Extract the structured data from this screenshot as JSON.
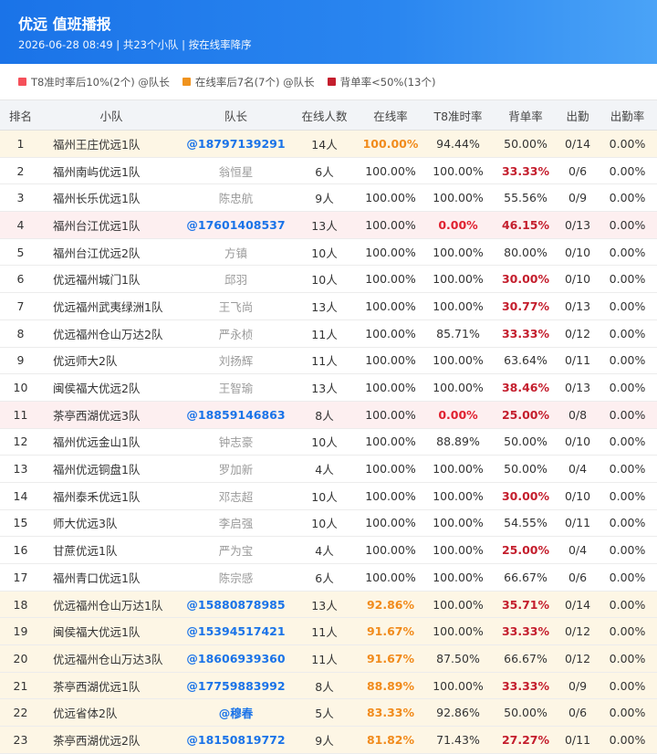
{
  "header": {
    "title": "优远 值班播报",
    "subtitle": "2026-06-28 08:49 | 共23个小队 | 按在线率降序"
  },
  "legend": [
    {
      "label": "T8准时率后10%(2个) @队长",
      "color": "#f5505a"
    },
    {
      "label": "在线率后7名(7个) @队长",
      "color": "#f0931e"
    },
    {
      "label": "背单率<50%(13个)",
      "color": "#c41e2d"
    }
  ],
  "columns": [
    "排名",
    "小队",
    "队长",
    "在线人数",
    "在线率",
    "T8准时率",
    "背单率",
    "出勤",
    "出勤率"
  ],
  "rows": [
    {
      "rank": "1",
      "team": "福州王庄优远1队",
      "leader": "@18797139291",
      "online_count": "14人",
      "online_rate": "100.00%",
      "t8_rate": "94.44%",
      "back_rate": "50.00%",
      "attendance": "0/14",
      "attendance_rate": "0.00%",
      "highlight": "orange",
      "leader_style": "blue",
      "online_style": "orange",
      "t8_style": "",
      "back_style": ""
    },
    {
      "rank": "2",
      "team": "福州南屿优远1队",
      "leader": "翁恒星",
      "online_count": "6人",
      "online_rate": "100.00%",
      "t8_rate": "100.00%",
      "back_rate": "33.33%",
      "attendance": "0/6",
      "attendance_rate": "0.00%",
      "highlight": "",
      "leader_style": "gray",
      "online_style": "",
      "t8_style": "",
      "back_style": "red"
    },
    {
      "rank": "3",
      "team": "福州长乐优远1队",
      "leader": "陈忠航",
      "online_count": "9人",
      "online_rate": "100.00%",
      "t8_rate": "100.00%",
      "back_rate": "55.56%",
      "attendance": "0/9",
      "attendance_rate": "0.00%",
      "highlight": "",
      "leader_style": "gray",
      "online_style": "",
      "t8_style": "",
      "back_style": ""
    },
    {
      "rank": "4",
      "team": "福州台江优远1队",
      "leader": "@17601408537",
      "online_count": "13人",
      "online_rate": "100.00%",
      "t8_rate": "0.00%",
      "back_rate": "46.15%",
      "attendance": "0/13",
      "attendance_rate": "0.00%",
      "highlight": "red",
      "leader_style": "blue",
      "online_style": "",
      "t8_style": "red",
      "back_style": "red"
    },
    {
      "rank": "5",
      "team": "福州台江优远2队",
      "leader": "方镇",
      "online_count": "10人",
      "online_rate": "100.00%",
      "t8_rate": "100.00%",
      "back_rate": "80.00%",
      "attendance": "0/10",
      "attendance_rate": "0.00%",
      "highlight": "",
      "leader_style": "gray",
      "online_style": "",
      "t8_style": "",
      "back_style": ""
    },
    {
      "rank": "6",
      "team": "优远福州城门1队",
      "leader": "邱羽",
      "online_count": "10人",
      "online_rate": "100.00%",
      "t8_rate": "100.00%",
      "back_rate": "30.00%",
      "attendance": "0/10",
      "attendance_rate": "0.00%",
      "highlight": "",
      "leader_style": "gray",
      "online_style": "",
      "t8_style": "",
      "back_style": "red"
    },
    {
      "rank": "7",
      "team": "优远福州武夷绿洲1队",
      "leader": "王飞尚",
      "online_count": "13人",
      "online_rate": "100.00%",
      "t8_rate": "100.00%",
      "back_rate": "30.77%",
      "attendance": "0/13",
      "attendance_rate": "0.00%",
      "highlight": "",
      "leader_style": "gray",
      "online_style": "",
      "t8_style": "",
      "back_style": "red"
    },
    {
      "rank": "8",
      "team": "优远福州仓山万达2队",
      "leader": "严永桢",
      "online_count": "11人",
      "online_rate": "100.00%",
      "t8_rate": "85.71%",
      "back_rate": "33.33%",
      "attendance": "0/12",
      "attendance_rate": "0.00%",
      "highlight": "",
      "leader_style": "gray",
      "online_style": "",
      "t8_style": "",
      "back_style": "red"
    },
    {
      "rank": "9",
      "team": "优远师大2队",
      "leader": "刘扬辉",
      "online_count": "11人",
      "online_rate": "100.00%",
      "t8_rate": "100.00%",
      "back_rate": "63.64%",
      "attendance": "0/11",
      "attendance_rate": "0.00%",
      "highlight": "",
      "leader_style": "gray",
      "online_style": "",
      "t8_style": "",
      "back_style": ""
    },
    {
      "rank": "10",
      "team": "闽侯福大优远2队",
      "leader": "王智瑜",
      "online_count": "13人",
      "online_rate": "100.00%",
      "t8_rate": "100.00%",
      "back_rate": "38.46%",
      "attendance": "0/13",
      "attendance_rate": "0.00%",
      "highlight": "",
      "leader_style": "gray",
      "online_style": "",
      "t8_style": "",
      "back_style": "red"
    },
    {
      "rank": "11",
      "team": "茶亭西湖优远3队",
      "leader": "@18859146863",
      "online_count": "8人",
      "online_rate": "100.00%",
      "t8_rate": "0.00%",
      "back_rate": "25.00%",
      "attendance": "0/8",
      "attendance_rate": "0.00%",
      "highlight": "red",
      "leader_style": "blue",
      "online_style": "",
      "t8_style": "red",
      "back_style": "red"
    },
    {
      "rank": "12",
      "team": "福州优远金山1队",
      "leader": "钟志豪",
      "online_count": "10人",
      "online_rate": "100.00%",
      "t8_rate": "88.89%",
      "back_rate": "50.00%",
      "attendance": "0/10",
      "attendance_rate": "0.00%",
      "highlight": "",
      "leader_style": "gray",
      "online_style": "",
      "t8_style": "",
      "back_style": ""
    },
    {
      "rank": "13",
      "team": "福州优远铜盘1队",
      "leader": "罗加新",
      "online_count": "4人",
      "online_rate": "100.00%",
      "t8_rate": "100.00%",
      "back_rate": "50.00%",
      "attendance": "0/4",
      "attendance_rate": "0.00%",
      "highlight": "",
      "leader_style": "gray",
      "online_style": "",
      "t8_style": "",
      "back_style": ""
    },
    {
      "rank": "14",
      "team": "福州泰禾优远1队",
      "leader": "邓志超",
      "online_count": "10人",
      "online_rate": "100.00%",
      "t8_rate": "100.00%",
      "back_rate": "30.00%",
      "attendance": "0/10",
      "attendance_rate": "0.00%",
      "highlight": "",
      "leader_style": "gray",
      "online_style": "",
      "t8_style": "",
      "back_style": "red"
    },
    {
      "rank": "15",
      "team": "师大优远3队",
      "leader": "李启强",
      "online_count": "10人",
      "online_rate": "100.00%",
      "t8_rate": "100.00%",
      "back_rate": "54.55%",
      "attendance": "0/11",
      "attendance_rate": "0.00%",
      "highlight": "",
      "leader_style": "gray",
      "online_style": "",
      "t8_style": "",
      "back_style": ""
    },
    {
      "rank": "16",
      "team": "甘蔗优远1队",
      "leader": "严为宝",
      "online_count": "4人",
      "online_rate": "100.00%",
      "t8_rate": "100.00%",
      "back_rate": "25.00%",
      "attendance": "0/4",
      "attendance_rate": "0.00%",
      "highlight": "",
      "leader_style": "gray",
      "online_style": "",
      "t8_style": "",
      "back_style": "red"
    },
    {
      "rank": "17",
      "team": "福州青口优远1队",
      "leader": "陈宗感",
      "online_count": "6人",
      "online_rate": "100.00%",
      "t8_rate": "100.00%",
      "back_rate": "66.67%",
      "attendance": "0/6",
      "attendance_rate": "0.00%",
      "highlight": "",
      "leader_style": "gray",
      "online_style": "",
      "t8_style": "",
      "back_style": ""
    },
    {
      "rank": "18",
      "team": "优远福州仓山万达1队",
      "leader": "@15880878985",
      "online_count": "13人",
      "online_rate": "92.86%",
      "t8_rate": "100.00%",
      "back_rate": "35.71%",
      "attendance": "0/14",
      "attendance_rate": "0.00%",
      "highlight": "orange",
      "leader_style": "blue",
      "online_style": "orange",
      "t8_style": "",
      "back_style": "red"
    },
    {
      "rank": "19",
      "team": "闽侯福大优远1队",
      "leader": "@15394517421",
      "online_count": "11人",
      "online_rate": "91.67%",
      "t8_rate": "100.00%",
      "back_rate": "33.33%",
      "attendance": "0/12",
      "attendance_rate": "0.00%",
      "highlight": "orange",
      "leader_style": "blue",
      "online_style": "orange",
      "t8_style": "",
      "back_style": "red"
    },
    {
      "rank": "20",
      "team": "优远福州仓山万达3队",
      "leader": "@18606939360",
      "online_count": "11人",
      "online_rate": "91.67%",
      "t8_rate": "87.50%",
      "back_rate": "66.67%",
      "attendance": "0/12",
      "attendance_rate": "0.00%",
      "highlight": "orange",
      "leader_style": "blue",
      "online_style": "orange",
      "t8_style": "",
      "back_style": ""
    },
    {
      "rank": "21",
      "team": "茶亭西湖优远1队",
      "leader": "@17759883992",
      "online_count": "8人",
      "online_rate": "88.89%",
      "t8_rate": "100.00%",
      "back_rate": "33.33%",
      "attendance": "0/9",
      "attendance_rate": "0.00%",
      "highlight": "orange",
      "leader_style": "blue",
      "online_style": "orange",
      "t8_style": "",
      "back_style": "red"
    },
    {
      "rank": "22",
      "team": "优远省体2队",
      "leader": "@穆春",
      "online_count": "5人",
      "online_rate": "83.33%",
      "t8_rate": "92.86%",
      "back_rate": "50.00%",
      "attendance": "0/6",
      "attendance_rate": "0.00%",
      "highlight": "orange",
      "leader_style": "blue",
      "online_style": "orange",
      "t8_style": "",
      "back_style": ""
    },
    {
      "rank": "23",
      "team": "茶亭西湖优远2队",
      "leader": "@18150819772",
      "online_count": "9人",
      "online_rate": "81.82%",
      "t8_rate": "71.43%",
      "back_rate": "27.27%",
      "attendance": "0/11",
      "attendance_rate": "0.00%",
      "highlight": "orange",
      "leader_style": "blue",
      "online_style": "orange",
      "t8_style": "",
      "back_style": "red"
    }
  ]
}
